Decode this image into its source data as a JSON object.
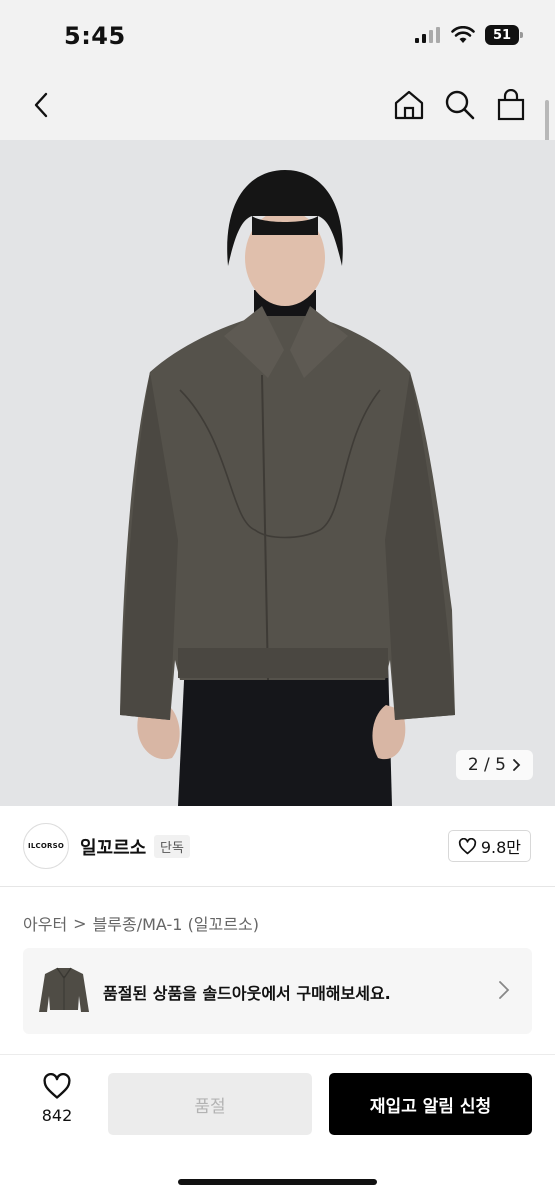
{
  "status_bar": {
    "time": "5:45",
    "battery": "51"
  },
  "nav": {
    "back_icon": "chevron-left-icon",
    "home_icon": "home-icon",
    "search_icon": "search-icon",
    "bag_icon": "shopping-bag-icon"
  },
  "gallery": {
    "counter": "2 / 5"
  },
  "brand": {
    "logo_text": "ILCORSO",
    "name": "일꼬르소",
    "badge": "단독",
    "likes": "9.8만"
  },
  "breadcrumb": {
    "level1": "아우터",
    "separator": ">",
    "level2": "블루종/MA-1 (일꼬르소)"
  },
  "soldout_banner": {
    "text": "품절된 상품을 솔드아웃에서 구매해보세요."
  },
  "bottom_bar": {
    "like_count": "842",
    "soldout_label": "품절",
    "restock_label": "재입고 알림 신청"
  },
  "colors": {
    "primary_button": "#000000",
    "disabled_button": "#ececec",
    "header_bg": "#f2f2f2"
  }
}
